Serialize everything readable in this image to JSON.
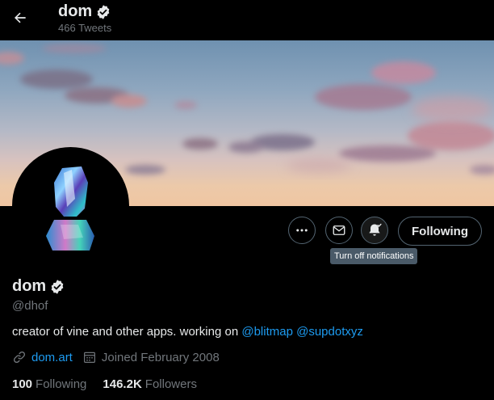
{
  "header": {
    "name": "dom",
    "tweet_count": "466 Tweets"
  },
  "profile": {
    "name": "dom",
    "handle": "@dhof",
    "bio_text": "creator of vine and other apps. working on ",
    "bio_mentions": [
      "@blitmap",
      "@supdotxyz"
    ],
    "website": "dom.art",
    "joined": "Joined February 2008"
  },
  "actions": {
    "following_label": "Following",
    "tooltip": "Turn off notifications"
  },
  "stats": {
    "following_count": "100",
    "following_label": "Following",
    "followers_count": "146.2K",
    "followers_label": "Followers"
  },
  "icons": {
    "back": "arrow-left-icon",
    "verified": "verified-badge-icon",
    "more": "more-dots-icon",
    "message": "envelope-icon",
    "notifications": "bell-check-icon",
    "link": "link-icon",
    "calendar": "calendar-icon"
  },
  "colors": {
    "background": "#000000",
    "text": "#e7e9ea",
    "muted": "#71767b",
    "accent": "#1d9bf0",
    "border": "#536471",
    "tooltip": "#4a5a68"
  }
}
